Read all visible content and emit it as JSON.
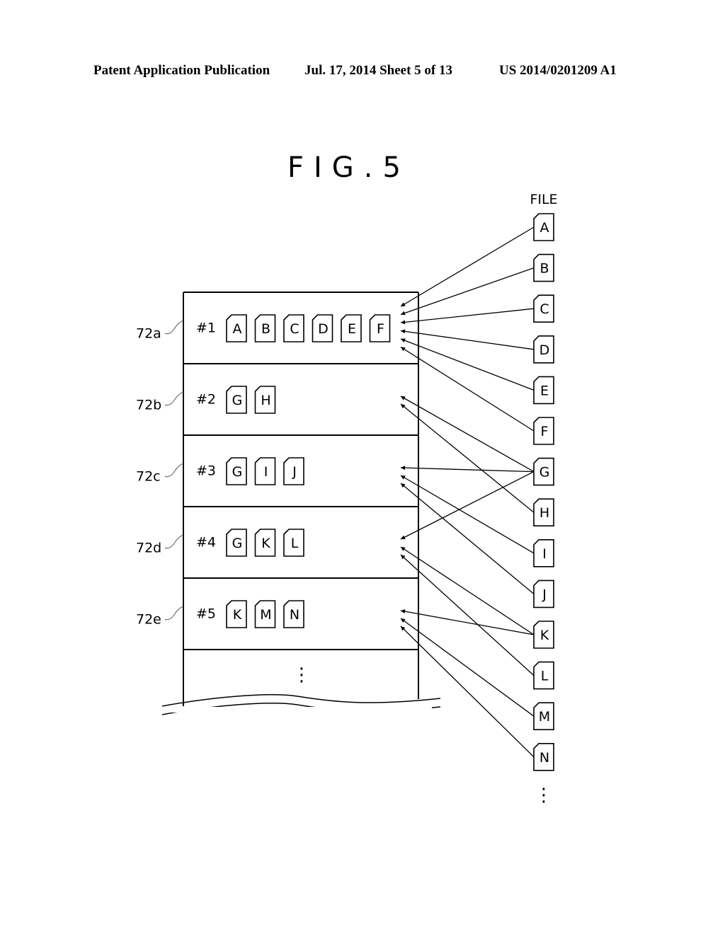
{
  "header": {
    "publication": "Patent Application Publication",
    "date_sheet": "Jul. 17, 2014   Sheet 5 of 13",
    "number": "US 2014/0201209 A1"
  },
  "figure": {
    "title": "FIG.5",
    "file_column_label": "FILE",
    "ellipsis": "⋮"
  },
  "regions": [
    {
      "ref": "72a",
      "label": "#1",
      "files": [
        "A",
        "B",
        "C",
        "D",
        "E",
        "F"
      ]
    },
    {
      "ref": "72b",
      "label": "#2",
      "files": [
        "G",
        "H"
      ]
    },
    {
      "ref": "72c",
      "label": "#3",
      "files": [
        "G",
        "I",
        "J"
      ]
    },
    {
      "ref": "72d",
      "label": "#4",
      "files": [
        "G",
        "K",
        "L"
      ]
    },
    {
      "ref": "72e",
      "label": "#5",
      "files": [
        "K",
        "M",
        "N"
      ]
    }
  ],
  "files": [
    "A",
    "B",
    "C",
    "D",
    "E",
    "F",
    "G",
    "H",
    "I",
    "J",
    "K",
    "L",
    "M",
    "N"
  ],
  "arrows": [
    {
      "from": "A",
      "to": "#1"
    },
    {
      "from": "B",
      "to": "#1"
    },
    {
      "from": "C",
      "to": "#1"
    },
    {
      "from": "D",
      "to": "#1"
    },
    {
      "from": "E",
      "to": "#1"
    },
    {
      "from": "F",
      "to": "#1"
    },
    {
      "from": "G",
      "to": "#2"
    },
    {
      "from": "H",
      "to": "#2"
    },
    {
      "from": "G",
      "to": "#3"
    },
    {
      "from": "I",
      "to": "#3"
    },
    {
      "from": "J",
      "to": "#3"
    },
    {
      "from": "G",
      "to": "#4"
    },
    {
      "from": "K",
      "to": "#4"
    },
    {
      "from": "L",
      "to": "#4"
    },
    {
      "from": "K",
      "to": "#5"
    },
    {
      "from": "M",
      "to": "#5"
    },
    {
      "from": "N",
      "to": "#5"
    }
  ]
}
